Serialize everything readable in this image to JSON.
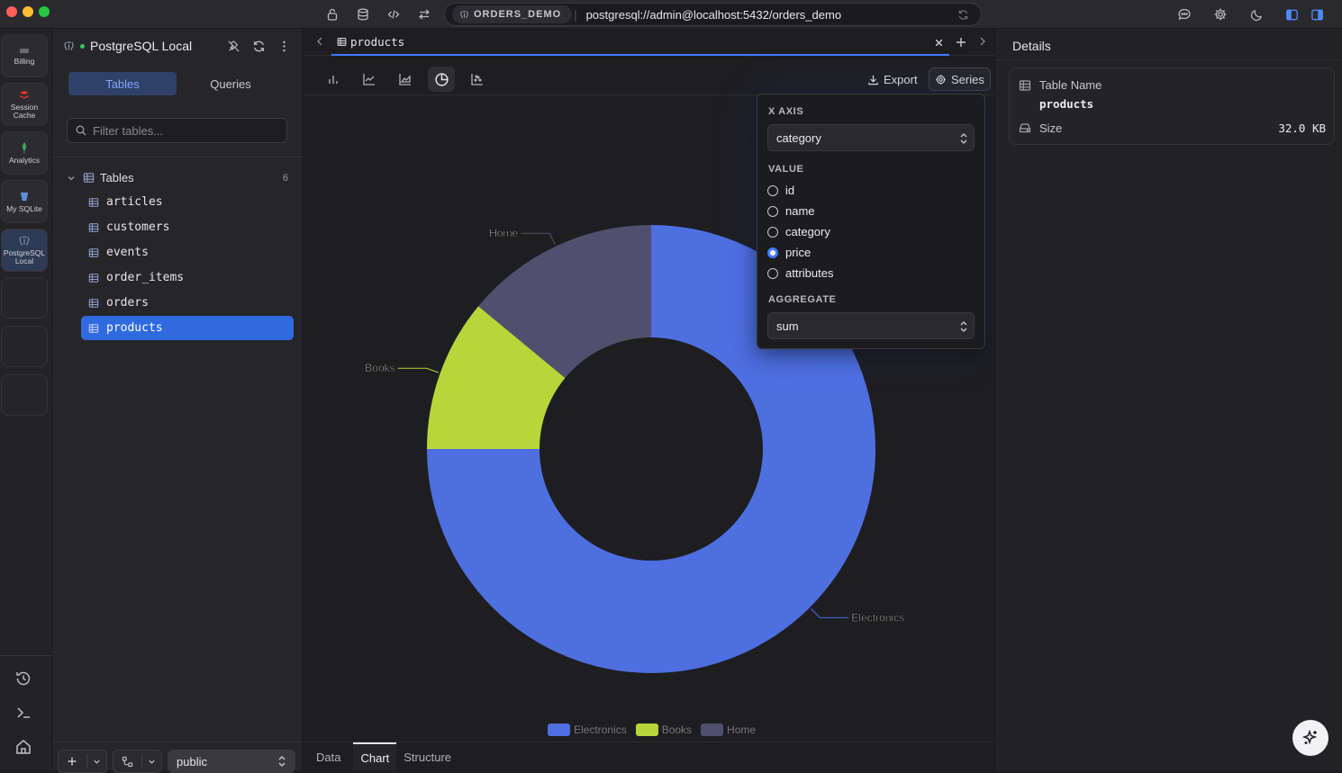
{
  "titlebar": {
    "connection_name": "ORDERS_DEMO",
    "connection_url": "postgresql://admin@localhost:5432/orders_demo"
  },
  "rail": {
    "items": [
      {
        "label": "Billing"
      },
      {
        "label": "Session Cache"
      },
      {
        "label": "Analytics"
      },
      {
        "label": "My SQLite"
      },
      {
        "label": "PostgreSQL Local"
      }
    ]
  },
  "sidebar": {
    "connection_title": "PostgreSQL Local",
    "tabs": [
      "Tables",
      "Queries"
    ],
    "filter_placeholder": "Filter tables...",
    "tables_heading": "Tables",
    "tables_count": "6",
    "tables": [
      "articles",
      "customers",
      "events",
      "order_items",
      "orders",
      "products"
    ],
    "selected_table": "products",
    "schema": "public"
  },
  "main": {
    "tab_title": "products",
    "toolbar": {
      "export_label": "Export",
      "series_label": "Series"
    },
    "bottom_tabs": [
      "Data",
      "Chart",
      "Structure"
    ],
    "active_bottom_tab": "Chart"
  },
  "series_popover": {
    "x_axis_label": "X AXIS",
    "x_axis_value": "category",
    "value_label": "VALUE",
    "value_options": [
      "id",
      "name",
      "category",
      "price",
      "attributes"
    ],
    "selected_value": "price",
    "aggregate_label": "AGGREGATE",
    "aggregate_value": "sum"
  },
  "chart_data": {
    "type": "pie",
    "style": "donut",
    "categories": [
      "Electronics",
      "Books",
      "Home"
    ],
    "values": [
      75,
      11,
      14
    ],
    "colors": [
      "#4e6fe0",
      "#b8d63a",
      "#50506e"
    ],
    "legend_position": "bottom-center"
  },
  "details": {
    "title": "Details",
    "table_name_label": "Table Name",
    "table_name_value": "products",
    "size_label": "Size",
    "size_value": "32.0 KB"
  }
}
